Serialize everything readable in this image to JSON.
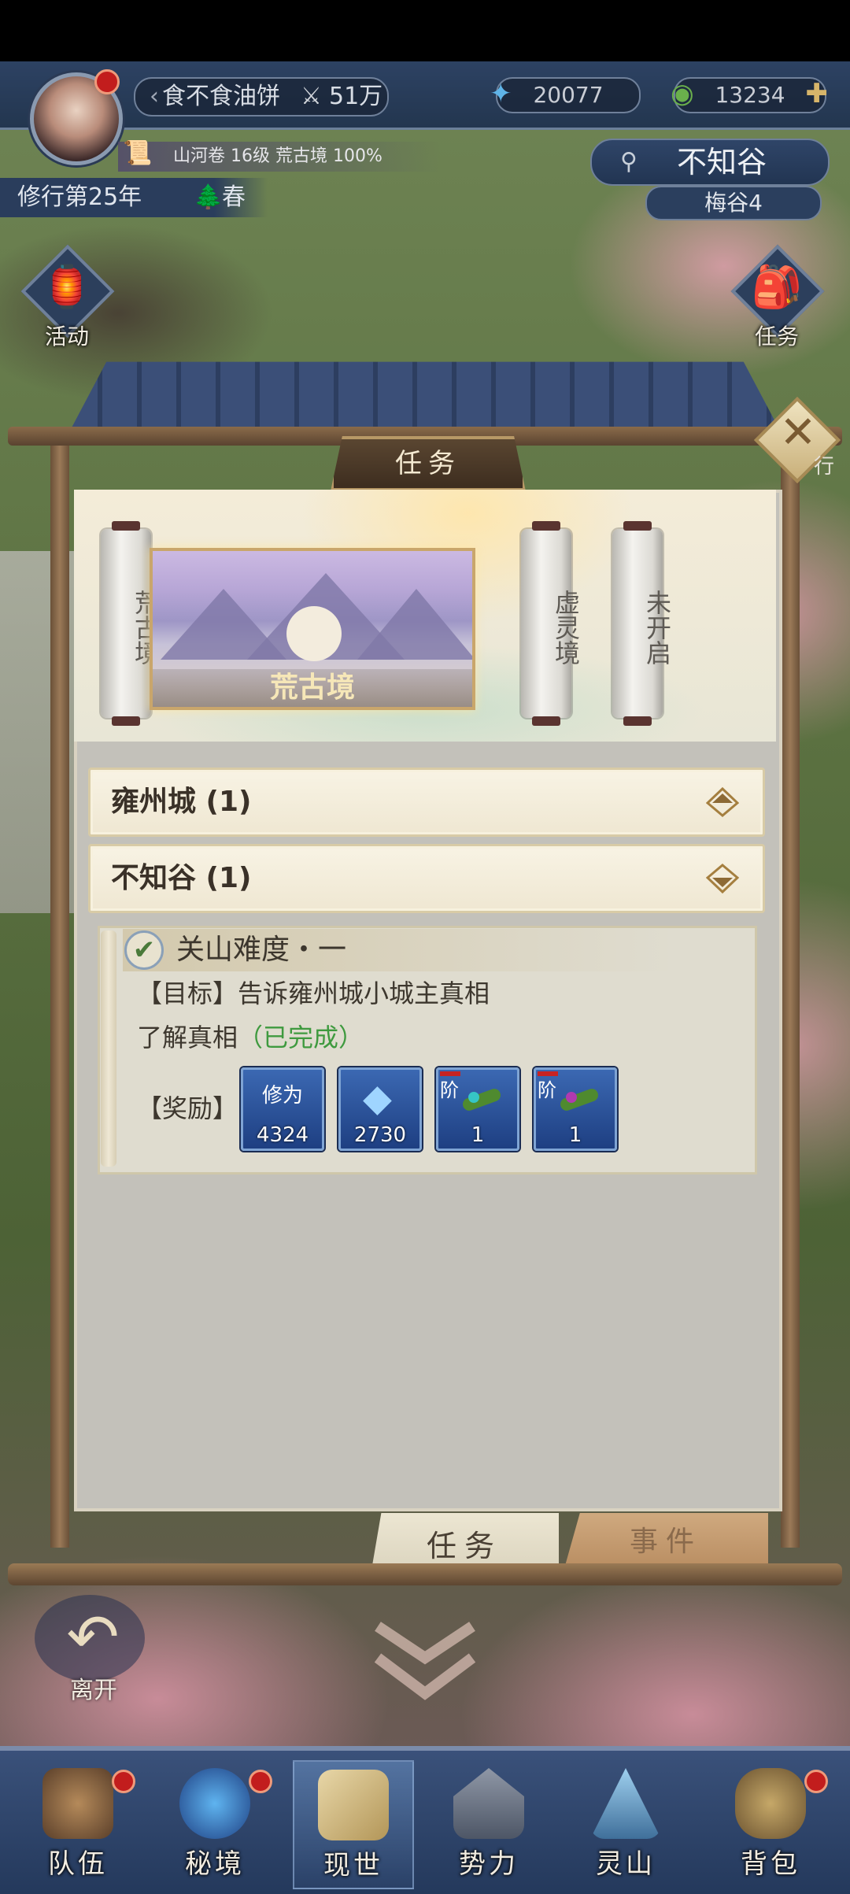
{
  "header": {
    "player_name": "食不食油饼",
    "power": "51万",
    "currency_spirit": "20077",
    "currency_jade": "13234",
    "progress_text": "山河卷 16级 荒古境 100%",
    "cultivation_year": "修行第25年",
    "season": "春",
    "location": "不知谷",
    "sub_location": "梅谷4"
  },
  "side_buttons": {
    "activity": "活动",
    "tasks": "任务",
    "cut_label": "行"
  },
  "panel": {
    "title": "任务",
    "realms": {
      "scroll_left": "荒古境",
      "card_caption": "荒古境",
      "scroll_mid": "虚灵境",
      "scroll_right": "未开启"
    },
    "regions": [
      {
        "label": "雍州城 (1)",
        "state": "collapsed"
      },
      {
        "label": "不知谷 (1)",
        "state": "expanded"
      }
    ],
    "quest": {
      "title": "关山难度・一",
      "objective": "【目标】告诉雍州城小城主真相",
      "progress_text": "了解真相",
      "progress_status": "（已完成）",
      "reward_label": "【奖励】",
      "rewards": [
        {
          "top": "修为",
          "count": "4324",
          "icon": "cultivation-icon"
        },
        {
          "top": "",
          "count": "2730",
          "icon": "crystal-icon"
        },
        {
          "tier": "阶",
          "count": "1",
          "icon": "herb-icon"
        },
        {
          "tier": "阶",
          "count": "1",
          "icon": "herb-icon"
        }
      ]
    },
    "tabs": {
      "tasks": "任务",
      "events": "事件"
    }
  },
  "leave_label": "离开",
  "bottom_nav": [
    {
      "label": "队伍",
      "has_dot": true
    },
    {
      "label": "秘境",
      "has_dot": true
    },
    {
      "label": "现世",
      "has_dot": false
    },
    {
      "label": "势力",
      "has_dot": false
    },
    {
      "label": "灵山",
      "has_dot": false
    },
    {
      "label": "背包",
      "has_dot": true
    }
  ],
  "colors": {
    "hud_bg": "#2d4263",
    "quest_complete": "#3f9a3f",
    "card_border": "#c9a66b",
    "alert_dot": "#c21d1d"
  }
}
